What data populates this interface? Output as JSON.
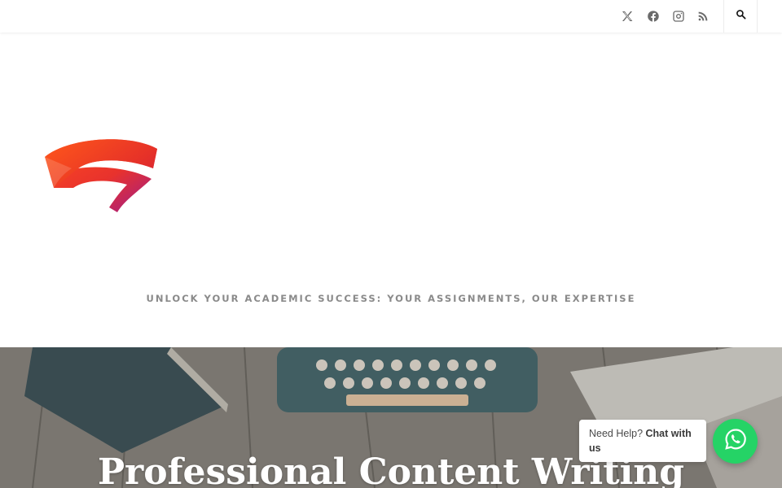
{
  "header": {
    "social_icons": [
      "x-twitter-icon",
      "facebook-icon",
      "instagram-icon",
      "rss-icon"
    ],
    "search_icon": "search-icon"
  },
  "branding": {
    "logo": "stadia-style-logo",
    "tagline": "UNLOCK YOUR ACADEMIC SUCCESS: YOUR ASSIGNMENTS, OUR EXPERTISE"
  },
  "hero": {
    "title": "Professional Content Writing"
  },
  "chat_widget": {
    "prefix": "Need Help?",
    "cta": "Chat with us",
    "icon": "whatsapp-icon",
    "color": "#25d366"
  },
  "colors": {
    "logo_start": "#ff4b1f",
    "logo_end": "#9b1b8f"
  }
}
